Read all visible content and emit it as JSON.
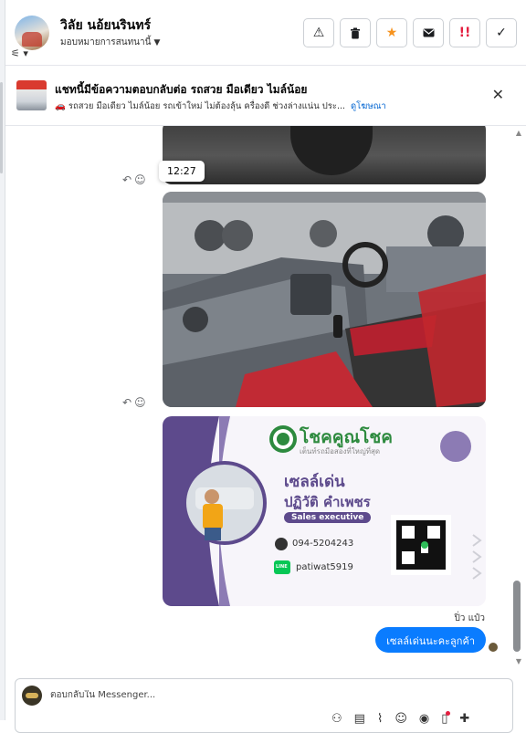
{
  "header": {
    "name": "วิลัย นอ้ยนรินทร์",
    "assign_label": "มอบหมายการสนทนานี้"
  },
  "banner": {
    "title": "แชทนี้มีข้อความตอบกลับต่อ รถสวย มือเดียว ไมล์น้อย",
    "subtitle": "🚗 รถสวย มือเดียว ไมล์น้อย รถเข้าใหม่ ไม่ต้องลุ้น ครื่องดี ช่วงล่างแน่น ประ...",
    "link": "ดูโฆษณา"
  },
  "chat": {
    "tooltip_time": "12:27",
    "sender_name": "ปิ่ว แป๋ว",
    "outgoing_message": "เซลล์เด่นนะคะลูกค้า"
  },
  "business_card": {
    "company": "โชคคูณโชค",
    "tagline": "เต็นท์รถมือสองที่ใหญ่ที่สุด",
    "nickname": "เซลล์เด่น",
    "full_name": "ปฏิวัติ คำเพชร",
    "position": "Sales executive",
    "phone": "094-5204243",
    "line_id": "patiwat5919",
    "line_label": "LINE"
  },
  "composer": {
    "placeholder": "ตอบกลับใน Messenger..."
  },
  "colors": {
    "accent_blue": "#0a7cff",
    "card_purple": "#5d4a8c",
    "card_green": "#2d8a3e",
    "star_orange": "#f7931e",
    "urgent_red": "#e41e3f"
  },
  "icons": {
    "actions": [
      "warning-icon",
      "trash-icon",
      "star-icon",
      "mail-icon",
      "urgent-icon",
      "check-icon"
    ],
    "composer_tools": [
      "add-person-icon",
      "bag-icon",
      "attach-icon",
      "emoji-icon",
      "gif-icon",
      "mobile-icon",
      "plus-icon"
    ]
  }
}
